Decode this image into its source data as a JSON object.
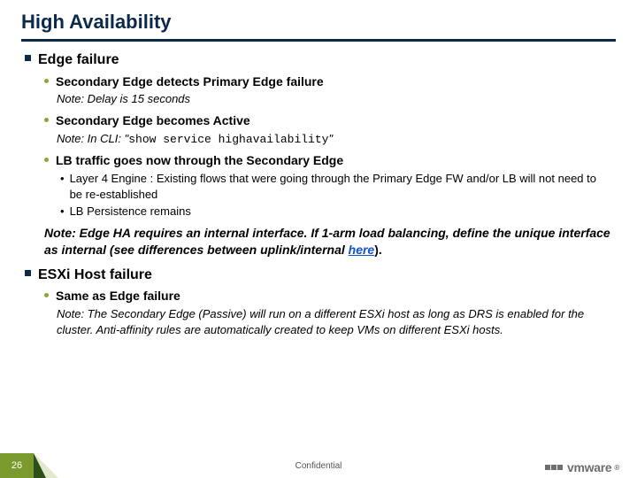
{
  "title": "High Availability",
  "sections": [
    {
      "heading": "Edge failure",
      "items": [
        {
          "label": "Secondary Edge detects Primary Edge failure",
          "note_prefix": "Note: Delay is 15 seconds",
          "note_code": ""
        },
        {
          "label": "Secondary Edge becomes Active",
          "note_prefix": "Note: In CLI: \"",
          "note_code": "show service highavailability",
          "note_suffix": "\""
        },
        {
          "label": "LB traffic goes now through the Secondary Edge",
          "sub": [
            "Layer 4 Engine : Existing flows that were going through the Primary Edge FW and/or LB will not need to be re-established",
            "LB Persistence remains"
          ]
        }
      ],
      "big_note_pre": "Note: Edge HA requires an internal interface. If 1-arm load balancing, define the unique interface as internal (see differences between uplink/internal ",
      "big_note_link": "here",
      "big_note_post": ")."
    },
    {
      "heading": "ESXi Host failure",
      "items": [
        {
          "label": "Same as Edge failure",
          "note_prefix": "Note: The Secondary Edge (Passive) will run on a different ESXi host as long as DRS is enabled for the cluster. Anti-affinity rules are automatically created to keep VMs on different ESXi hosts.",
          "note_code": ""
        }
      ]
    }
  ],
  "footer": {
    "page": "26",
    "confidential": "Confidential",
    "logo_text": "vmware",
    "logo_r": "®"
  }
}
